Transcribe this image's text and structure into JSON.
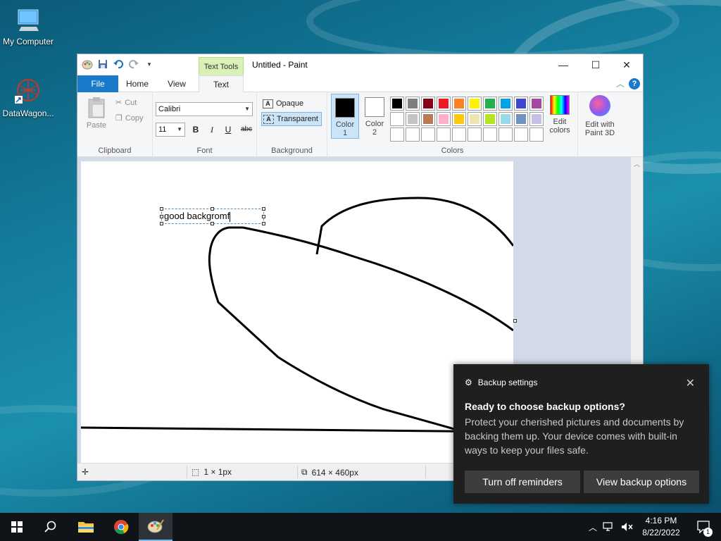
{
  "desktop": {
    "icons": [
      {
        "label": "My Computer",
        "icon": "computer-icon"
      },
      {
        "label": "DataWagon...",
        "icon": "datawagon-shortcut-icon"
      }
    ]
  },
  "window": {
    "title": "Untitled - Paint",
    "context_tab": "Text Tools",
    "tabs": {
      "file": "File",
      "home": "Home",
      "view": "View",
      "text": "Text"
    },
    "controls": {
      "minimize": "—",
      "maximize": "☐",
      "close": "✕"
    },
    "help": "?"
  },
  "ribbon": {
    "clipboard": {
      "paste": "Paste",
      "cut": "Cut",
      "copy": "Copy",
      "label": "Clipboard"
    },
    "font": {
      "family": "Calibri",
      "size": "11",
      "bold": "B",
      "italic": "I",
      "underline": "U",
      "strike": "abc",
      "label": "Font"
    },
    "background": {
      "opaque": "Opaque",
      "transparent": "Transparent",
      "label": "Background"
    },
    "colors": {
      "color1_label_a": "Color",
      "color1_label_b": "1",
      "color2_label_a": "Color",
      "color2_label_b": "2",
      "color1": "#000000",
      "color2": "#ffffff",
      "edit_colors_a": "Edit",
      "edit_colors_b": "colors",
      "paint3d_a": "Edit with",
      "paint3d_b": "Paint 3D",
      "label": "Colors",
      "palette": [
        "#000000",
        "#7f7f7f",
        "#880015",
        "#ed1c24",
        "#ff7f27",
        "#fff200",
        "#22b14c",
        "#00a2e8",
        "#3f48cc",
        "#a349a4",
        "#ffffff",
        "#c3c3c3",
        "#b97a57",
        "#ffaec9",
        "#ffc90e",
        "#efe4b0",
        "#b5e61d",
        "#99d9ea",
        "#7092be",
        "#c8bfe7",
        "",
        "",
        "",
        "",
        "",
        "",
        "",
        "",
        "",
        ""
      ]
    }
  },
  "canvas": {
    "text_box_value": "good backgromf"
  },
  "statusbar": {
    "selection_size": "1 × 1px",
    "canvas_size": "614 × 460px"
  },
  "toast": {
    "app": "Backup settings",
    "title": "Ready to choose backup options?",
    "body": "Protect your cherished pictures and documents by backing them up. Your device comes with built-in ways to keep your files safe.",
    "button_off": "Turn off reminders",
    "button_view": "View backup options",
    "close": "✕"
  },
  "taskbar": {
    "time": "4:16 PM",
    "date": "8/22/2022",
    "notification_count": "1"
  }
}
